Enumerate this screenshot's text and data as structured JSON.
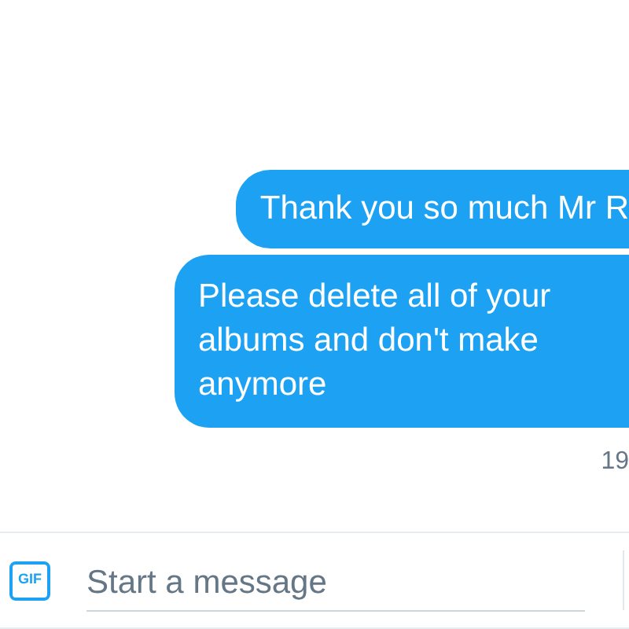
{
  "messages": [
    {
      "text": "Thank you so much Mr R"
    },
    {
      "text": "Please delete all of your albums and don't make anymore"
    }
  ],
  "timestamp": "19",
  "composer": {
    "gif_label": "GIF",
    "placeholder": "Start a message"
  }
}
